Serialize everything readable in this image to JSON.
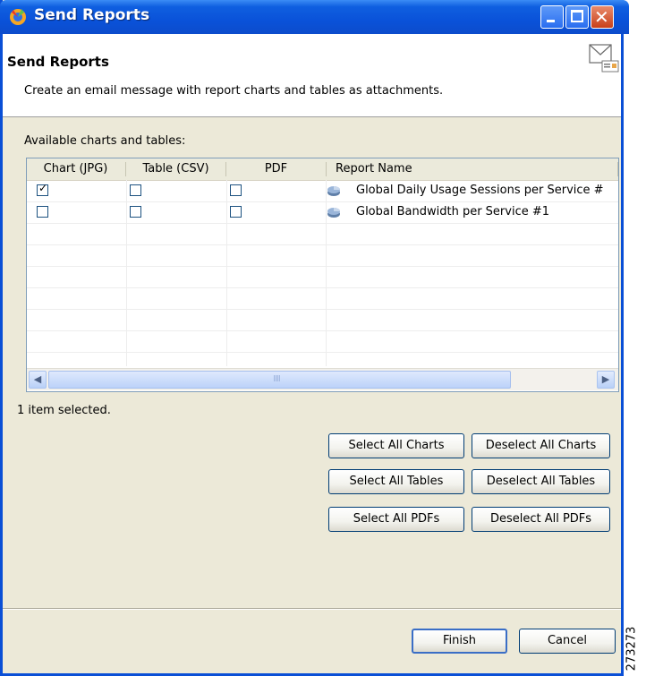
{
  "window": {
    "title": "Send Reports",
    "controls": {
      "minimize": "minimize",
      "maximize": "maximize",
      "close": "✕"
    }
  },
  "header": {
    "title": "Send Reports",
    "description": "Create an email message with report charts and tables as attachments."
  },
  "section_label": "Available charts and tables:",
  "table": {
    "columns": [
      "Chart (JPG)",
      "Table (CSV)",
      "PDF",
      "Report Name"
    ],
    "rows": [
      {
        "chart": true,
        "table": false,
        "pdf": false,
        "name": "Global Daily Usage Sessions per Service #"
      },
      {
        "chart": false,
        "table": false,
        "pdf": false,
        "name": "Global Bandwidth per Service #1"
      }
    ]
  },
  "status": "1 item selected.",
  "buttons": {
    "select_all_charts": "Select All Charts",
    "deselect_all_charts": "Deselect All Charts",
    "select_all_tables": "Select All Tables",
    "deselect_all_tables": "Deselect All Tables",
    "select_all_pdfs": "Select All PDFs",
    "deselect_all_pdfs": "Deselect All PDFs",
    "finish": "Finish",
    "cancel": "Cancel"
  },
  "side_id": "273273",
  "icons": {
    "app": "app-icon",
    "mail": "mail-icon",
    "report": "report-icon",
    "scroll_left": "◀",
    "scroll_right": "▶",
    "checkmark": "✓",
    "grip": "IIII"
  },
  "colors": {
    "titlebar": "#0a52d9",
    "window_bg": "#ece9d8",
    "default_button_border": "#3a6ec6"
  }
}
